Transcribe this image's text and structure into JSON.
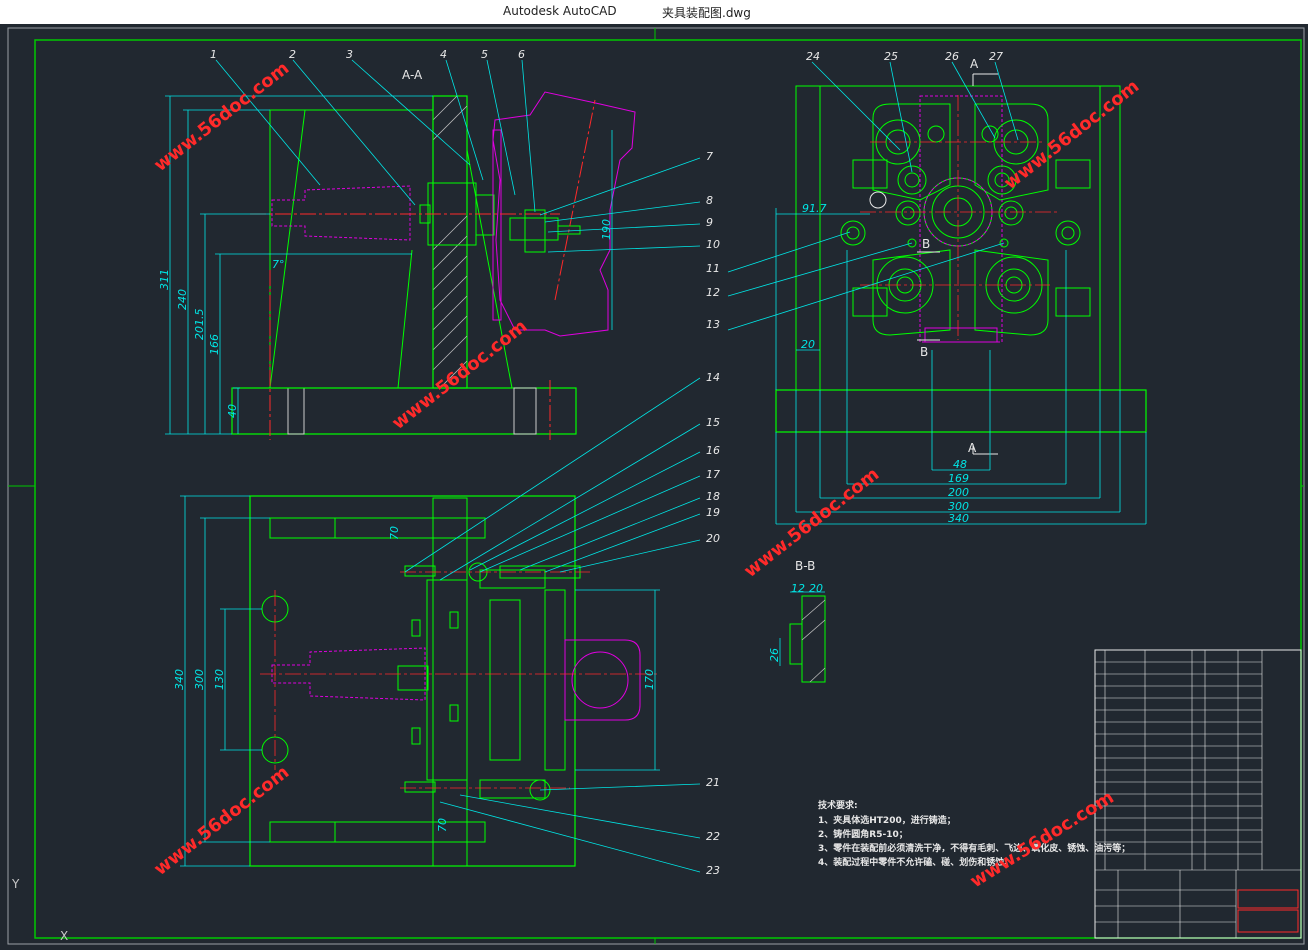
{
  "window": {
    "app_name": "Autodesk AutoCAD",
    "file_name": "夹具装配图.dwg"
  },
  "colors": {
    "background": "#212830",
    "frame": "#00c800",
    "part": "#00ff00",
    "dimension": "#00e5e5",
    "centerline": "#ff2a2a",
    "workpiece": "#e000e0",
    "watermark": "#ff2a2a"
  },
  "drawing": {
    "view_labels": {
      "section_aa": "A-A",
      "section_bb": "B-B",
      "arrow_a_top": "A",
      "arrow_a_bottom": "A",
      "arrow_b_top": "B",
      "arrow_b_bottom": "B"
    },
    "part_numbers": [
      "1",
      "2",
      "3",
      "4",
      "5",
      "6",
      "7",
      "8",
      "9",
      "10",
      "11",
      "12",
      "13",
      "14",
      "15",
      "16",
      "17",
      "18",
      "19",
      "20",
      "21",
      "22",
      "23",
      "24",
      "25",
      "26",
      "27"
    ],
    "dimensions": {
      "aa_311": "311",
      "aa_240": "240",
      "aa_2015": "201.5",
      "aa_166": "166",
      "aa_40": "40",
      "aa_190": "190",
      "aa_angle": "7°",
      "top_917": "91.7",
      "top_20": "20",
      "top_48": "48",
      "top_169": "169",
      "top_200": "200",
      "top_300": "300",
      "top_340": "340",
      "plan_340": "340",
      "plan_300": "300",
      "plan_130": "130",
      "plan_170": "170",
      "plan_70a": "70",
      "plan_70b": "70",
      "bb_12": "12",
      "bb_20": "20",
      "bb_26": "26"
    },
    "tech_notes": {
      "heading": "技术要求:",
      "lines": [
        "1、夹具体选HT200，进行铸造；",
        "2、铸件圆角R5-10；",
        "3、零件在装配前必须清洗干净，不得有毛刺、飞边、氧化皮、锈蚀、油污等；",
        "4、装配过程中零件不允许磕、碰、划伤和锈蚀。"
      ]
    },
    "watermark_text": "www.56doc.com"
  },
  "icons": {
    "ucs_y": "ucs-y-axis-icon",
    "ucs_x": "ucs-x-axis-icon"
  },
  "ucs": {
    "y": "Y",
    "x": "X"
  }
}
